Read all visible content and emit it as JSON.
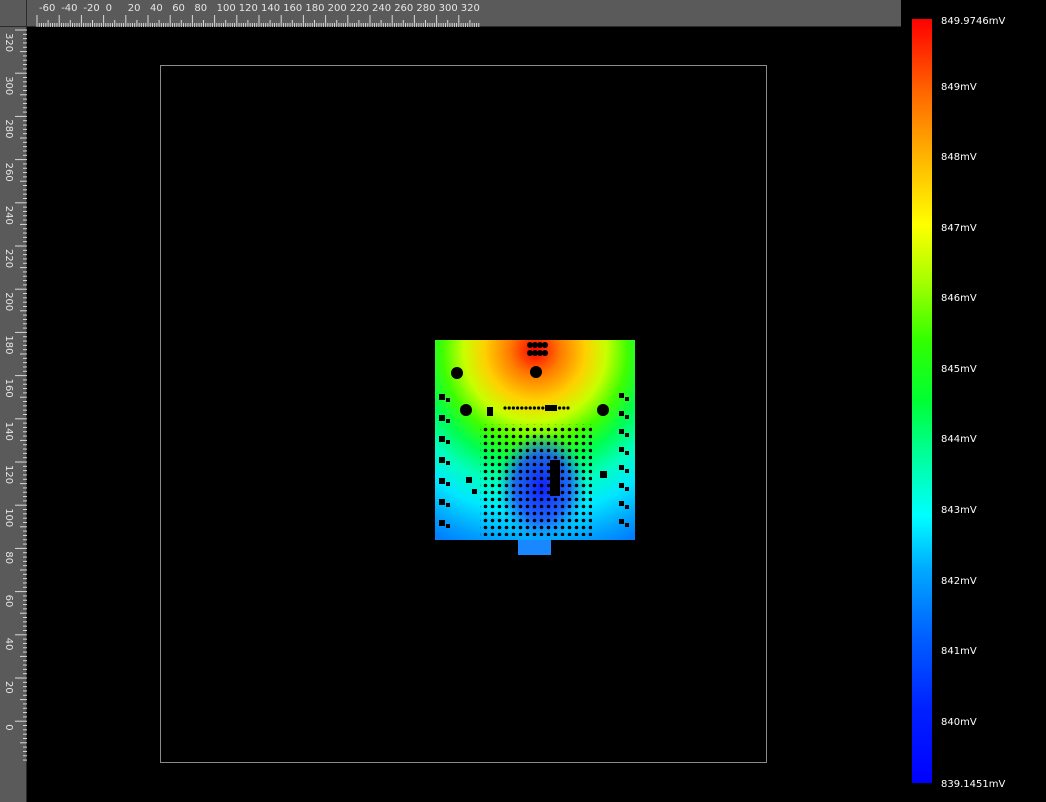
{
  "ruler_top": {
    "labels": [
      "-60",
      "-40",
      "-20",
      "0",
      "20",
      "40",
      "60",
      "80",
      "100",
      "120",
      "140",
      "160",
      "180",
      "200",
      "220",
      "240",
      "260",
      "280",
      "300",
      "320"
    ]
  },
  "ruler_left": {
    "labels": [
      "320",
      "300",
      "280",
      "260",
      "240",
      "220",
      "200",
      "180",
      "160",
      "140",
      "120",
      "100",
      "80",
      "60",
      "40",
      "20",
      "0"
    ]
  },
  "colorbar": {
    "max_label": "849.9746mV",
    "min_label": "839.1451mV",
    "tick_labels": [
      "849mV",
      "848mV",
      "847mV",
      "846mV",
      "845mV",
      "844mV",
      "843mV",
      "842mV",
      "841mV",
      "840mV"
    ],
    "max_value": 849.9746,
    "min_value": 839.1451,
    "colors": [
      "#ff0000",
      "#ffff00",
      "#00ff00",
      "#00ffff",
      "#0000ff"
    ]
  },
  "colors": {
    "background": "#000000",
    "ruler": "#5a5a5a",
    "outline": "#8a8a8a"
  }
}
